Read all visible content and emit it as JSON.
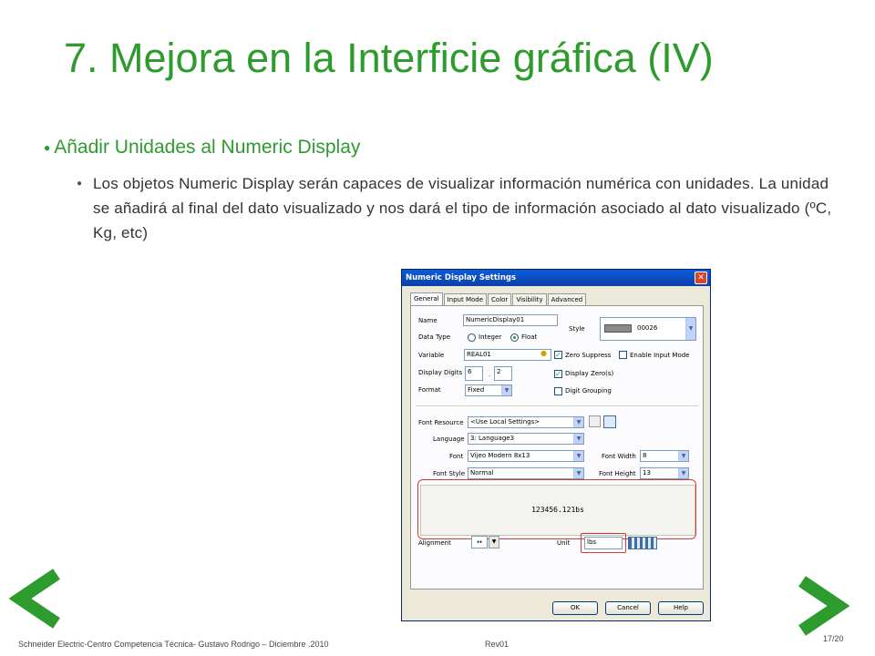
{
  "slide": {
    "title": "7. Mejora en la Interficie gráfica (IV)",
    "bullet_main": "Añadir Unidades al Numeric Display",
    "bullet_sub": "Los objetos Numeric Display serán capaces de visualizar información numérica con unidades. La unidad se añadirá al final del dato visualizado y nos dará el tipo de información asociado al dato visualizado (ºC, Kg, etc)"
  },
  "dialog": {
    "title": "Numeric Display Settings",
    "close": "✕",
    "tabs": [
      "General",
      "Input Mode",
      "Color",
      "Visibility",
      "Advanced"
    ],
    "active_tab": "General",
    "name_label": "Name",
    "name_value": "NumericDisplay01",
    "style_label": "Style",
    "style_value": "00026",
    "data_type_label": "Data Type",
    "radio_integer": "Integer",
    "radio_float": "Float",
    "selected_data_type": "Float",
    "variable_label": "Variable",
    "variable_value": "REAL01",
    "zero_suppress": "Zero Suppress",
    "enable_input_mode": "Enable Input Mode",
    "display_digits_label": "Display Digits",
    "digits_int": "6",
    "digits_sep": ".",
    "digits_dec": "2",
    "display_zero": "Display Zero(s)",
    "format_label": "Format",
    "format_value": "Fixed",
    "digit_grouping": "Digit Grouping",
    "font_resource_label": "Font Resource",
    "font_resource_value": "<Use Local Settings>",
    "language_label": "Language",
    "language_value": "3: Language3",
    "font_label": "Font",
    "font_value": "Vijeo Modern 8x13",
    "font_width_label": "Font Width",
    "font_width_value": "8",
    "font_style_label": "Font Style",
    "font_style_value": "Normal",
    "font_height_label": "Font Height",
    "font_height_value": "13",
    "preview_text": "123456.121bs",
    "alignment_label": "Alignment",
    "unit_label": "Unit",
    "unit_value": "lbs",
    "ok": "OK",
    "cancel": "Cancel",
    "help": "Help"
  },
  "footer": {
    "credit": "Schneider Electric-Centro Competencia Técnica- Gustavo Rodrigo – Diciembre .2010",
    "rev": "Rev01",
    "page": "17/20"
  },
  "colors": {
    "accent_green": "#2e9b2e",
    "highlight_red": "#d23a3a",
    "titlebar_blue": "#0a5cd8"
  }
}
